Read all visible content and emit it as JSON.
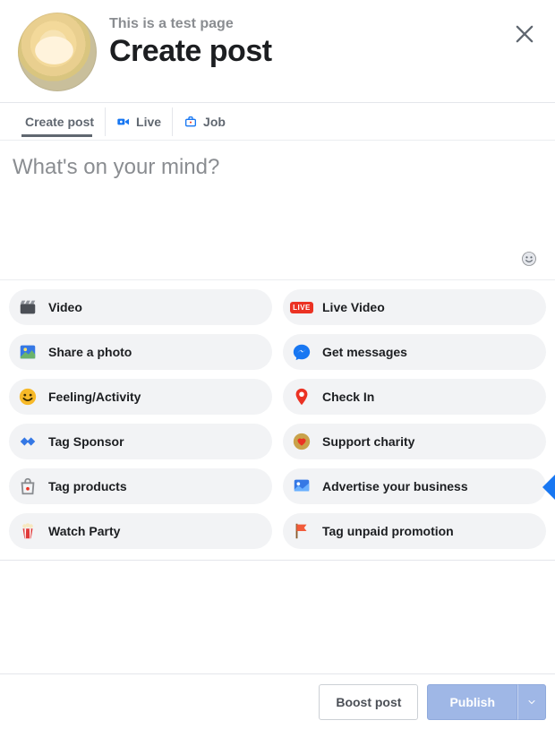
{
  "header": {
    "page_caption": "This is a test page",
    "title": "Create post"
  },
  "tabs": {
    "create_post": "Create post",
    "live": "Live",
    "job": "Job"
  },
  "composer": {
    "placeholder": "What's on your mind?"
  },
  "options": {
    "video": "Video",
    "live_video": "Live Video",
    "share_photo": "Share a photo",
    "get_messages": "Get messages",
    "feeling_activity": "Feeling/Activity",
    "check_in": "Check In",
    "tag_sponsor": "Tag Sponsor",
    "support_charity": "Support charity",
    "tag_products": "Tag products",
    "advertise_business": "Advertise your business",
    "watch_party": "Watch Party",
    "tag_unpaid_promotion": "Tag unpaid promotion",
    "live_badge": "LIVE"
  },
  "footer": {
    "boost_post": "Boost post",
    "publish": "Publish"
  },
  "colors": {
    "accent": "#1877f2",
    "pill_bg": "#f2f3f5",
    "primary_disabled": "#9fb7e6"
  }
}
